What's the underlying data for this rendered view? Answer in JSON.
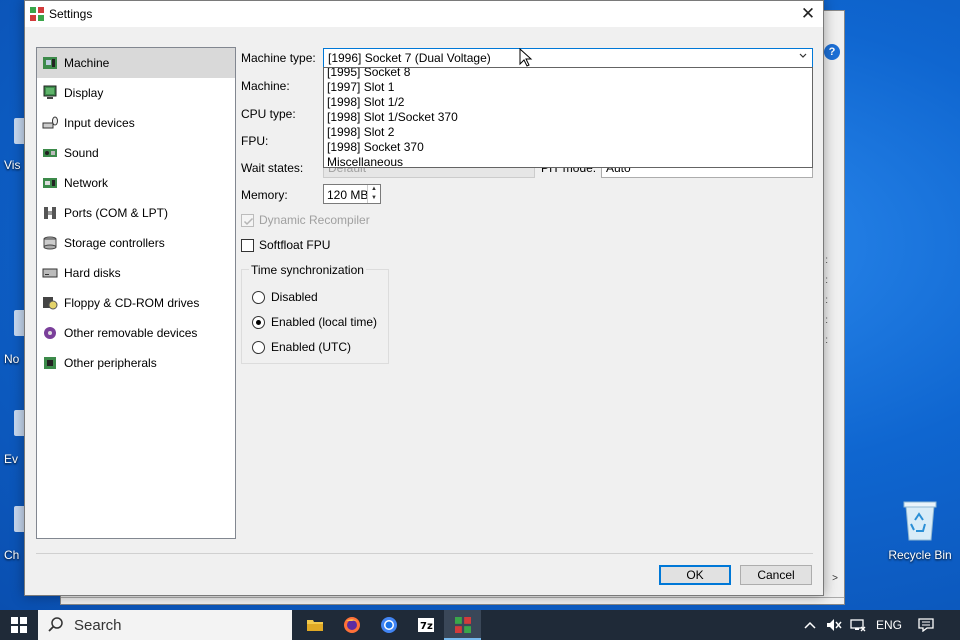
{
  "dialog": {
    "title": "Settings",
    "close_glyph": "✕"
  },
  "sidebar": {
    "items": [
      {
        "label": "Machine",
        "icon": "motherboard-icon",
        "selected": true
      },
      {
        "label": "Display",
        "icon": "display-icon"
      },
      {
        "label": "Input devices",
        "icon": "keyboard-mouse-icon"
      },
      {
        "label": "Sound",
        "icon": "sound-icon"
      },
      {
        "label": "Network",
        "icon": "network-icon"
      },
      {
        "label": "Ports (COM & LPT)",
        "icon": "ports-icon"
      },
      {
        "label": "Storage controllers",
        "icon": "storage-controller-icon"
      },
      {
        "label": "Hard disks",
        "icon": "hard-disk-icon"
      },
      {
        "label": "Floppy & CD-ROM drives",
        "icon": "floppy-cdrom-icon"
      },
      {
        "label": "Other removable devices",
        "icon": "removable-device-icon"
      },
      {
        "label": "Other peripherals",
        "icon": "peripheral-chip-icon"
      }
    ]
  },
  "machine": {
    "machine_type_label": "Machine type:",
    "machine_type_value": "[1996] Socket 7 (Dual Voltage)",
    "machine_label": "Machine:",
    "cpu_type_label": "CPU type:",
    "fpu_label": "FPU:",
    "wait_states_label": "Wait states:",
    "wait_states_value": "Default",
    "pit_mode_label": "PIT mode:",
    "pit_mode_value": "Auto",
    "memory_label": "Memory:",
    "memory_value": "120 MB",
    "dynamic_recompiler_label": "Dynamic Recompiler",
    "dynamic_recompiler_checked": true,
    "softfloat_label": "Softfloat FPU",
    "softfloat_checked": false
  },
  "dropdown": {
    "options": [
      "[1995] Socket 8",
      "[1997] Slot 1",
      "[1998] Slot 1/2",
      "[1998] Slot 1/Socket 370",
      "[1998] Slot 2",
      "[1998] Socket 370",
      "Miscellaneous"
    ]
  },
  "time_sync": {
    "title": "Time synchronization",
    "options": [
      {
        "label": "Disabled",
        "selected": false
      },
      {
        "label": "Enabled (local time)",
        "selected": true
      },
      {
        "label": "Enabled (UTC)",
        "selected": false
      }
    ]
  },
  "buttons": {
    "ok": "OK",
    "cancel": "Cancel"
  },
  "desktop": {
    "recycle_bin": "Recycle Bin",
    "edge_labels": [
      "Vis",
      "No",
      "Ev",
      "Ch"
    ]
  },
  "taskbar": {
    "search_placeholder": "Search",
    "apps": [
      "file-explorer-icon",
      "firefox-icon",
      "chrome-icon",
      "7zip-icon",
      "86box-icon"
    ],
    "language": "ENG"
  },
  "colors": {
    "accent": "#0078d7",
    "taskbar": "#1f2a38",
    "desktop": "#0f66d0"
  }
}
